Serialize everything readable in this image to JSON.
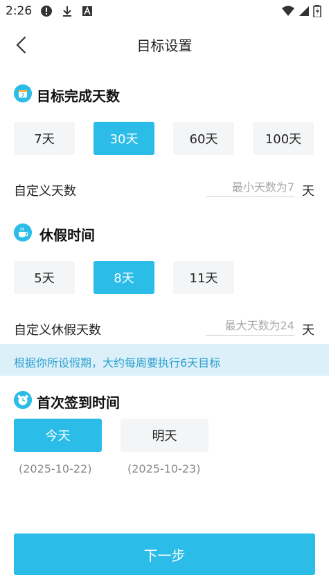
{
  "status_bar": {
    "time": "2:26",
    "icons": [
      "alert-circle-icon",
      "download-icon",
      "font-a-icon",
      "wifi-icon",
      "signal-icon",
      "battery-charging-icon"
    ]
  },
  "header": {
    "title": "目标设置",
    "back_icon": "chevron-left-icon"
  },
  "goal": {
    "title": "目标完成天数",
    "icon": "calendar-icon",
    "options": [
      "7天",
      "30天",
      "60天",
      "100天"
    ],
    "selected": "30天",
    "custom_label": "自定义天数",
    "custom_placeholder": "最小天数为7",
    "unit": "天"
  },
  "vacation": {
    "title": "休假时间",
    "icon": "coffee-cup-icon",
    "options": [
      "5天",
      "8天",
      "11天"
    ],
    "selected": "8天",
    "custom_label": "自定义休假天数",
    "custom_placeholder": "最大天数为24",
    "unit": "天"
  },
  "hint": {
    "text": "根据你所设假期，大约每周要执行6天目标"
  },
  "first_checkin": {
    "title": "首次签到时间",
    "icon": "alarm-clock-icon",
    "options": [
      {
        "label": "今天",
        "date": "(2025-10-22)"
      },
      {
        "label": "明天",
        "date": "(2025-10-23)"
      }
    ],
    "selected": "今天"
  },
  "footer": {
    "next_label": "下一步"
  },
  "colors": {
    "accent": "#2bbde8",
    "hint_bg": "#dcf0fa",
    "hint_text": "#2a9fcf",
    "option_bg": "#f4f5f7"
  }
}
